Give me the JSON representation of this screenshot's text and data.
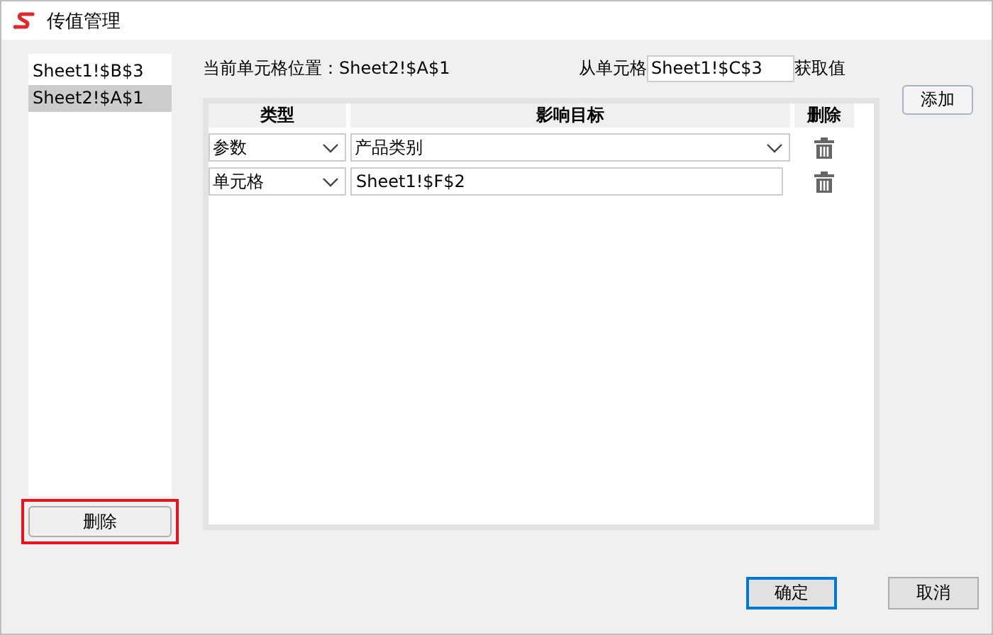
{
  "window": {
    "title": "传值管理"
  },
  "cell_list": {
    "items": [
      {
        "label": "Sheet1!$B$3",
        "selected": false
      },
      {
        "label": "Sheet2!$A$1",
        "selected": true
      }
    ],
    "delete_button": {
      "label": "删除",
      "highlighted": true
    }
  },
  "current_cell": "当前单元格位置：Sheet2!$A$1",
  "source": {
    "prefix": "从单元格",
    "value": "Sheet1!$C$3",
    "suffix": "获取值"
  },
  "add_button": "添加",
  "table": {
    "columns": [
      "类型",
      "影响目标",
      "删除"
    ],
    "rows": [
      {
        "kind": "dropdown",
        "type": "参数",
        "target": "产品类别"
      },
      {
        "kind": "text",
        "type": "单元格",
        "target": "Sheet1!$F$2"
      }
    ]
  },
  "buttons": [
    {
      "label": "确定",
      "default": true
    },
    {
      "label": "取消",
      "default": false
    }
  ]
}
